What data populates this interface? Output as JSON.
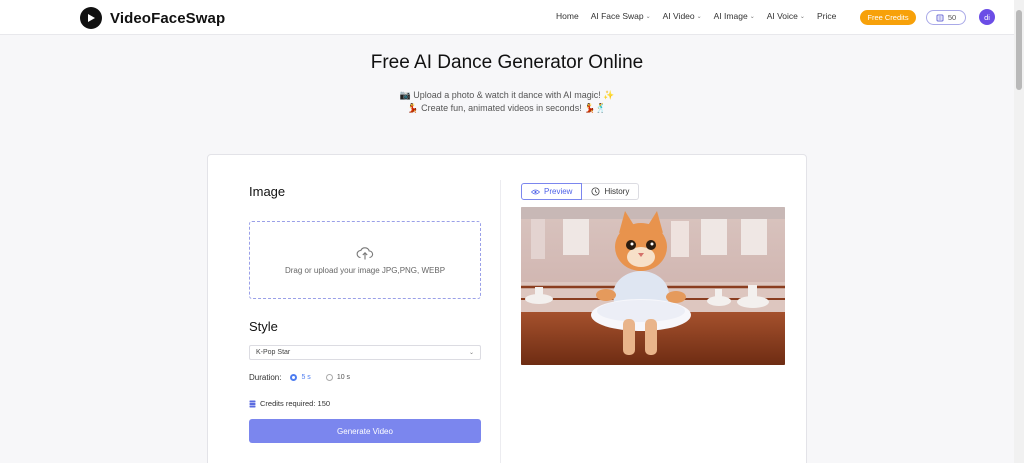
{
  "header": {
    "logo_text": "VideoFaceSwap",
    "nav": [
      {
        "label": "Home",
        "dropdown": false
      },
      {
        "label": "AI Face Swap",
        "dropdown": true
      },
      {
        "label": "AI Video",
        "dropdown": true
      },
      {
        "label": "AI Image",
        "dropdown": true
      },
      {
        "label": "AI Voice",
        "dropdown": true
      },
      {
        "label": "Price",
        "dropdown": false
      }
    ],
    "free_credits": "Free Credits",
    "credit_count": "50",
    "avatar_initials": "di",
    "accent": "#f7a10a"
  },
  "hero": {
    "title": "Free AI Dance Generator Online",
    "line1": "📷 Upload a photo & watch it dance with AI magic! ✨",
    "line2": "💃 Create fun, animated videos in seconds! 💃🕺"
  },
  "form": {
    "image_label": "Image",
    "upload_text": "Drag or upload your image JPG,PNG, WEBP",
    "style_label": "Style",
    "style_value": "K-Pop Star",
    "duration_label": "Duration:",
    "options": [
      {
        "label": "5 s",
        "selected": true
      },
      {
        "label": "10 s",
        "selected": false
      }
    ],
    "credits_required": "Credits required: 150",
    "generate_label": "Generate Video",
    "button_color": "#7b86ee"
  },
  "preview": {
    "tab_preview": "Preview",
    "tab_history": "History"
  }
}
